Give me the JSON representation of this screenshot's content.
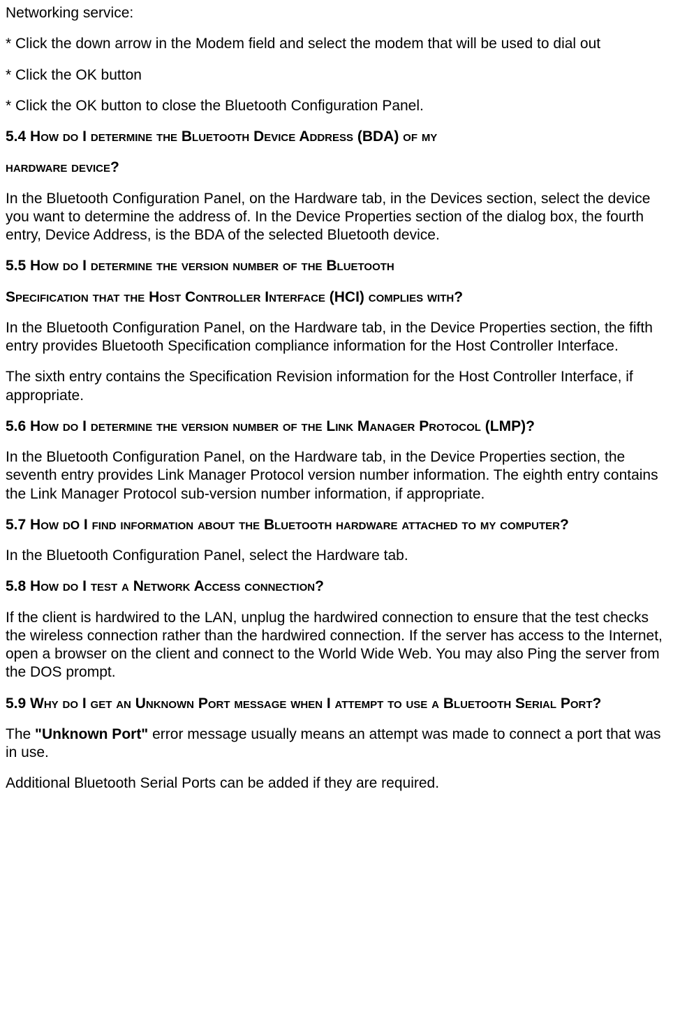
{
  "p1": "Networking service:",
  "p2": "* Click the down arrow in the Modem field and select the modem that will be used to dial out",
  "p3": "* Click the OK button",
  "p4": "* Click the OK button to close the Bluetooth Configuration Panel.",
  "h54a": "5.4 How do I determine the Bluetooth Device Address (BDA) of my",
  "h54b": "hardware device?",
  "p5": "In the Bluetooth Configuration Panel, on the Hardware tab, in the Devices section, select the device you want to determine the address of. In the Device Properties section of the dialog box, the fourth entry, Device Address, is the BDA of the selected Bluetooth device.",
  "h55a": "5.5 How do I determine the version number of the Bluetooth",
  "h55b": "Specification that the Host Controller Interface (HCI) complies with?",
  "p6": "In the Bluetooth Configuration Panel, on the Hardware tab, in the Device Properties section, the fifth entry provides Bluetooth Specification compliance information for the Host Controller Interface.",
  "p7": "The sixth entry contains the Specification Revision information for the Host Controller Interface, if appropriate.",
  "h56": "5.6 How do I determine the version number of the Link Manager Protocol (LMP)?",
  "p8": "In the Bluetooth Configuration Panel, on the Hardware tab, in the Device Properties section, the seventh entry provides Link Manager Protocol version number information. The eighth entry contains the Link Manager Protocol sub-version number information, if appropriate.",
  "h57_pre": "5.7 How d",
  "h57_o": "o",
  "h57_post": " I find information about the Bluetooth hardware attached to my computer?",
  "p9": "In the Bluetooth Configuration Panel, select the Hardware tab.",
  "h58": "5.8 How do I test a Network Access connection?",
  "p10": "If the client is hardwired to the LAN, unplug the hardwired connection to ensure that the test checks the wireless connection rather than the hardwired connection. If the server has access to the Internet, open a browser on the client and connect to the World Wide Web. You may also Ping the server from the DOS prompt.",
  "h59": "5.9 Why do I get an Unknown Port message when I attempt to use a Bluetooth Serial Port?",
  "p11a": "The ",
  "p11b": "\"Unknown Port\"",
  "p11c": " error message usually means an attempt was made to connect a port that was in use.",
  "p12": "Additional Bluetooth Serial Ports can be added if they are required."
}
